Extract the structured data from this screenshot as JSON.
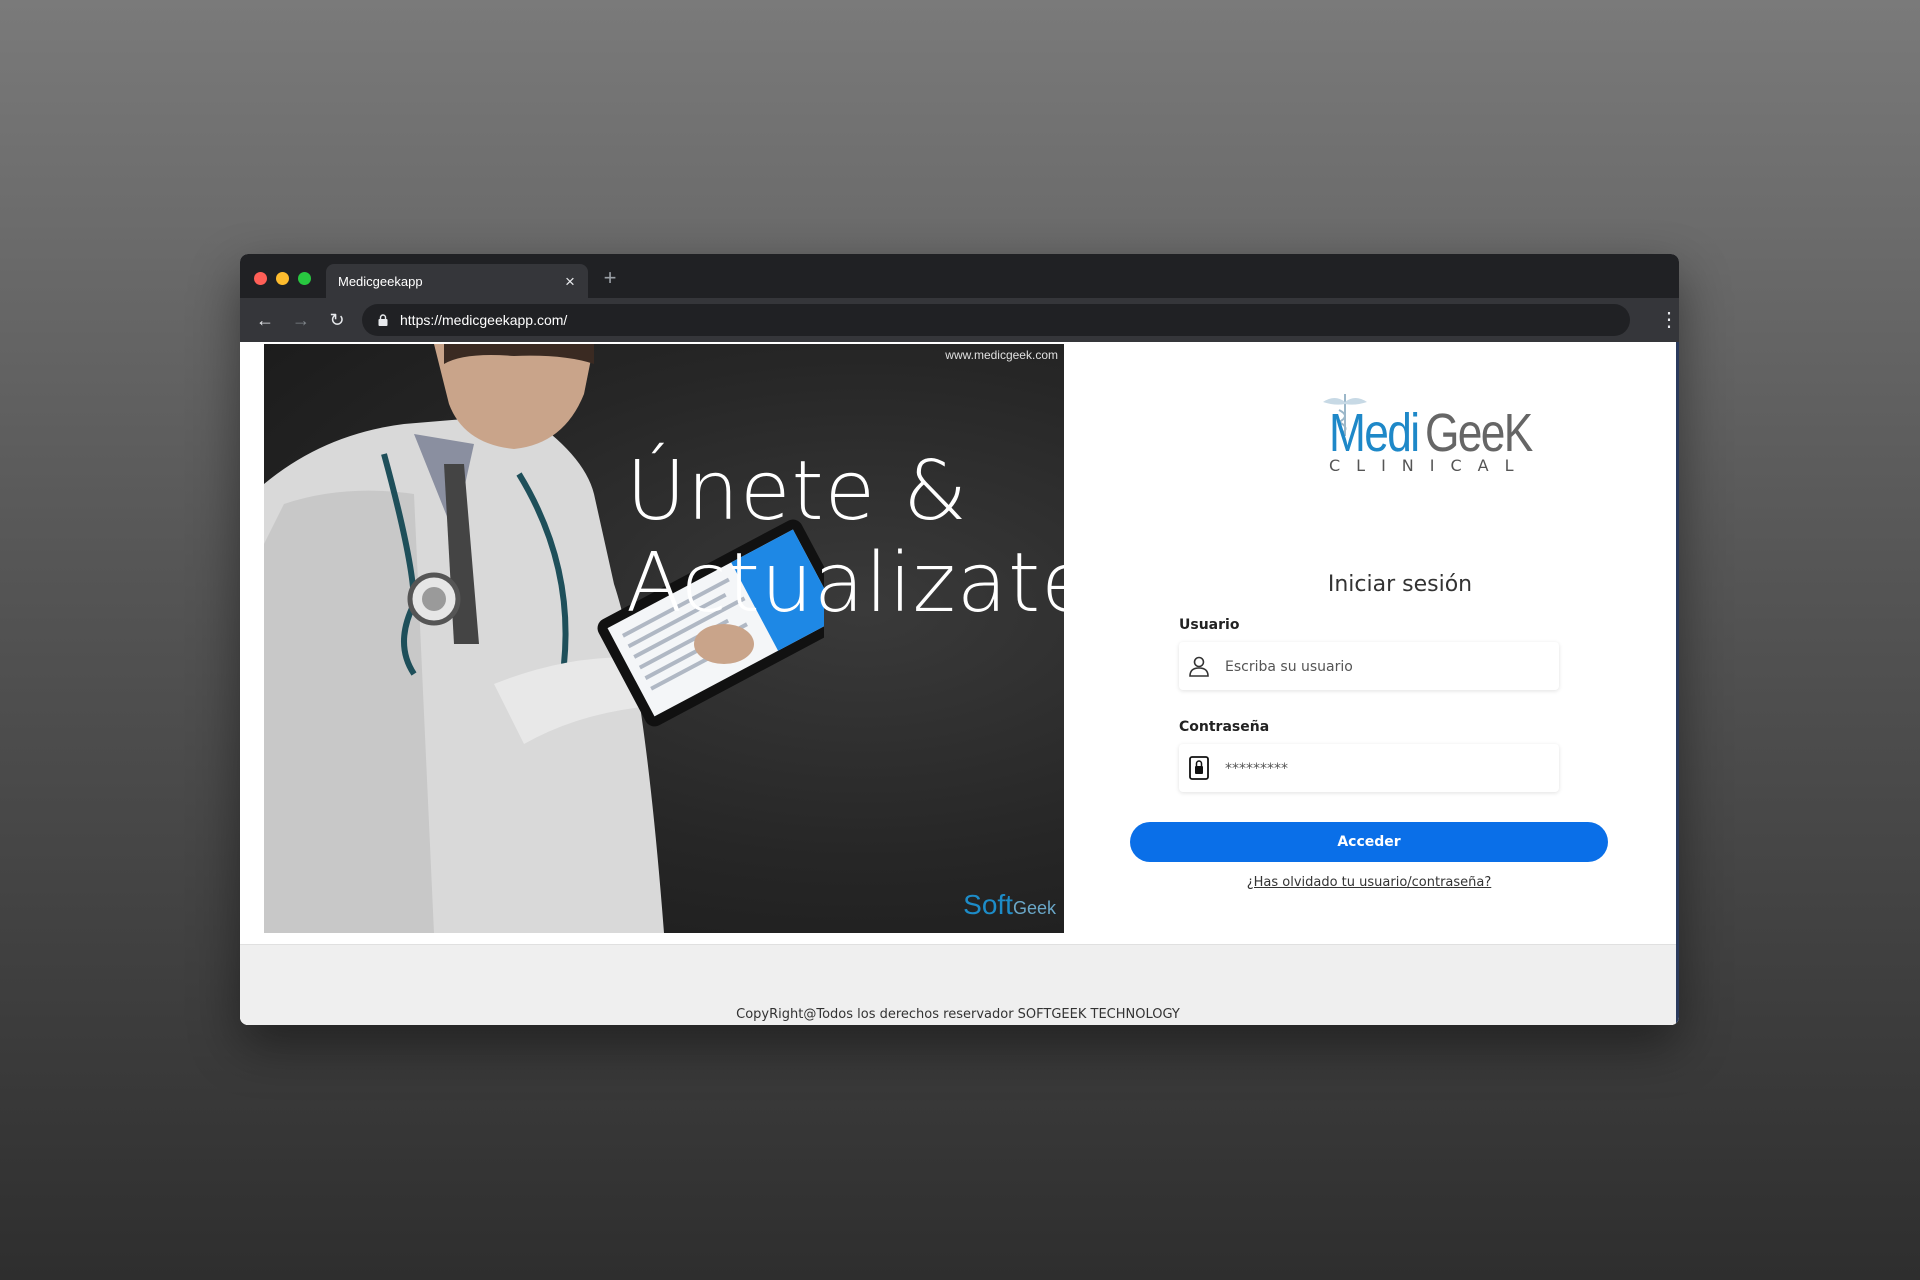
{
  "browser": {
    "tab_title": "Medicgeekapp",
    "close_glyph": "×",
    "new_tab_glyph": "+",
    "url": "https://medicgeekapp.com/",
    "back_glyph": "←",
    "forward_glyph": "→",
    "reload_glyph": "↻",
    "menu_glyph": "⋮"
  },
  "hero": {
    "watermark": "www.medicgeek.com",
    "headline_line1": "Únete &",
    "headline_line2": "Actualizate",
    "footer_logo_soft": "Soft",
    "footer_logo_geek": "Geek"
  },
  "brand": {
    "name_part1": "Medi",
    "name_part2": "GeeK",
    "subtitle": "CLINICAL",
    "accent_color": "#1e88c8"
  },
  "login": {
    "title": "Iniciar sesión",
    "username_label": "Usuario",
    "username_placeholder": "Escriba su usuario",
    "password_label": "Contraseña",
    "password_value": "*********",
    "submit_label": "Acceder",
    "forgot_link": "¿Has olvidado tu usuario/contraseña?",
    "button_color": "#0a6fe8"
  },
  "footer": {
    "text": "CopyRight@Todos los derechos reservador SOFTGEEK TECHNOLOGY"
  }
}
